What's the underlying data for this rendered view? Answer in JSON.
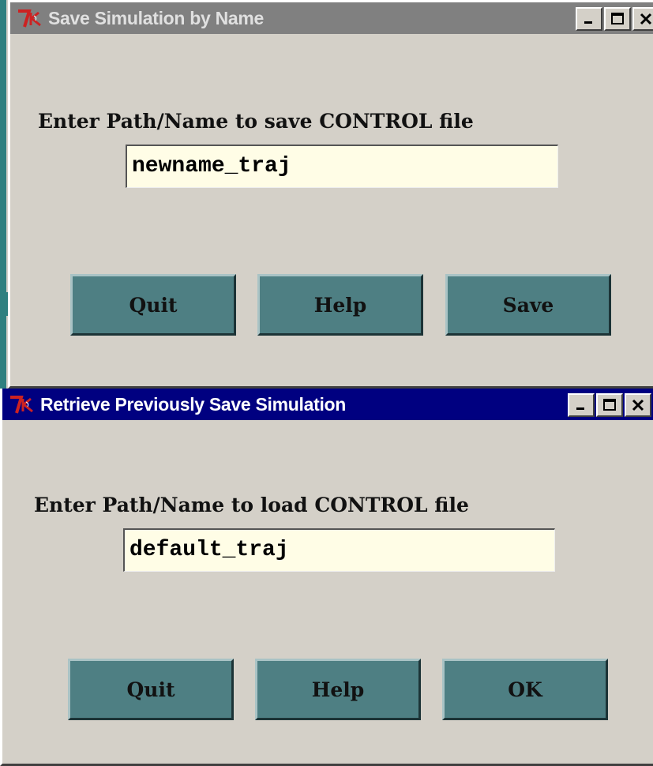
{
  "save_dialog": {
    "title": "Save Simulation by Name",
    "prompt": "Enter Path/Name to save CONTROL file",
    "field_value": "newname_traj",
    "buttons": {
      "quit": "Quit",
      "help": "Help",
      "save": "Save"
    },
    "active": false
  },
  "retrieve_dialog": {
    "title": "Retrieve Previously Save Simulation",
    "prompt": "Enter Path/Name to load CONTROL file",
    "field_value": "default_traj",
    "buttons": {
      "quit": "Quit",
      "help": "Help",
      "ok": "OK"
    },
    "active": true
  },
  "colors": {
    "button_face": "#4e7f83",
    "field_bg": "#fffde6",
    "active_title": "#000080",
    "inactive_title": "#808080",
    "tk_logo": "#cc2222"
  },
  "icons": {
    "app": "tk-logo-icon",
    "minimize": "minimize-icon",
    "maximize": "maximize-icon",
    "close": "close-icon"
  }
}
